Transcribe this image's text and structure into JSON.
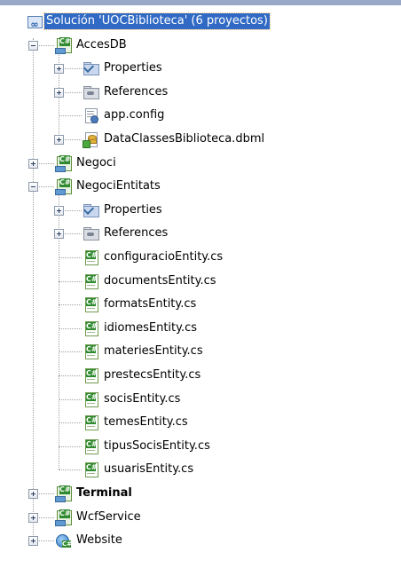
{
  "solution_explorer": {
    "items": [
      {
        "label": "Solución 'UOCBiblioteca' (6 proyectos)",
        "icon": "solution-icon",
        "level": 0,
        "expander": "none",
        "selected": true,
        "bold": false
      },
      {
        "label": "AccesDB",
        "icon": "csharp-project-icon",
        "level": 0,
        "expander": "minus",
        "selected": false,
        "bold": false
      },
      {
        "label": "Properties",
        "icon": "properties-folder-icon",
        "level": 1,
        "expander": "plus",
        "selected": false,
        "bold": false
      },
      {
        "label": "References",
        "icon": "references-folder-icon",
        "level": 1,
        "expander": "plus",
        "selected": false,
        "bold": false
      },
      {
        "label": "app.config",
        "icon": "config-file-icon",
        "level": 1,
        "expander": "none",
        "selected": false,
        "bold": false
      },
      {
        "label": "DataClassesBiblioteca.dbml",
        "icon": "dbml-file-icon",
        "level": 1,
        "expander": "plus",
        "selected": false,
        "bold": false
      },
      {
        "label": "Negoci",
        "icon": "csharp-project-icon",
        "level": 0,
        "expander": "plus",
        "selected": false,
        "bold": false
      },
      {
        "label": "NegociEntitats",
        "icon": "csharp-project-icon",
        "level": 0,
        "expander": "minus",
        "selected": false,
        "bold": false
      },
      {
        "label": "Properties",
        "icon": "properties-folder-icon",
        "level": 1,
        "expander": "plus",
        "selected": false,
        "bold": false
      },
      {
        "label": "References",
        "icon": "references-folder-icon",
        "level": 1,
        "expander": "plus",
        "selected": false,
        "bold": false
      },
      {
        "label": "configuracioEntity.cs",
        "icon": "csharp-file-icon",
        "level": 1,
        "expander": "none",
        "selected": false,
        "bold": false
      },
      {
        "label": "documentsEntity.cs",
        "icon": "csharp-file-icon",
        "level": 1,
        "expander": "none",
        "selected": false,
        "bold": false
      },
      {
        "label": "formatsEntity.cs",
        "icon": "csharp-file-icon",
        "level": 1,
        "expander": "none",
        "selected": false,
        "bold": false
      },
      {
        "label": "idiomesEntity.cs",
        "icon": "csharp-file-icon",
        "level": 1,
        "expander": "none",
        "selected": false,
        "bold": false
      },
      {
        "label": "materiesEntity.cs",
        "icon": "csharp-file-icon",
        "level": 1,
        "expander": "none",
        "selected": false,
        "bold": false
      },
      {
        "label": "prestecsEntity.cs",
        "icon": "csharp-file-icon",
        "level": 1,
        "expander": "none",
        "selected": false,
        "bold": false
      },
      {
        "label": "socisEntity.cs",
        "icon": "csharp-file-icon",
        "level": 1,
        "expander": "none",
        "selected": false,
        "bold": false
      },
      {
        "label": "temesEntity.cs",
        "icon": "csharp-file-icon",
        "level": 1,
        "expander": "none",
        "selected": false,
        "bold": false
      },
      {
        "label": "tipusSocisEntity.cs",
        "icon": "csharp-file-icon",
        "level": 1,
        "expander": "none",
        "selected": false,
        "bold": false
      },
      {
        "label": "usuarisEntity.cs",
        "icon": "csharp-file-icon",
        "level": 1,
        "expander": "none",
        "selected": false,
        "bold": false
      },
      {
        "label": "Terminal",
        "icon": "csharp-project-icon",
        "level": 0,
        "expander": "plus",
        "selected": false,
        "bold": true
      },
      {
        "label": "WcfService",
        "icon": "csharp-project-icon",
        "level": 0,
        "expander": "plus",
        "selected": false,
        "bold": false
      },
      {
        "label": "Website",
        "icon": "website-project-icon",
        "level": 0,
        "expander": "plus",
        "selected": false,
        "bold": false
      }
    ]
  },
  "colors": {
    "selection_bg": "#316ac5",
    "selection_fg": "#ffffff",
    "tree_lines": "#a0a0a0",
    "header_bar": "#97a9c6"
  }
}
